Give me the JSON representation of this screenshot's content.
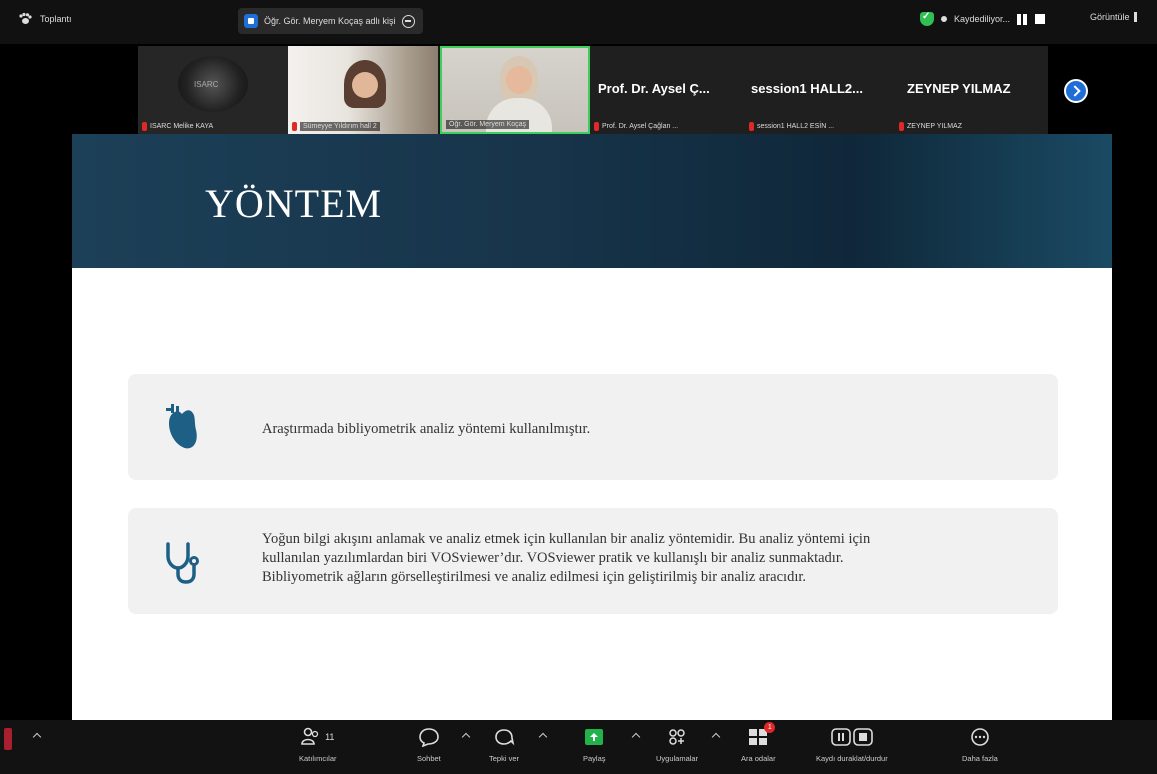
{
  "topbar": {
    "app_name": "Toplantı",
    "share_label": "Öğr. Gör. Meryem Koçaş adlı kişi",
    "recording_label": "Kaydediliyor...",
    "view_label": "Görüntüle"
  },
  "participants": [
    {
      "display": "logo",
      "name": "ISARC Melike KAYA"
    },
    {
      "display": "video",
      "name": "Sümeyye Yıldırım hall 2"
    },
    {
      "display": "video",
      "name": "Öğr. Gör. Meryem Koçaş"
    },
    {
      "display": "name",
      "big_name": "Prof. Dr. Aysel Ç...",
      "name": "Prof. Dr. Aysel Çağlan ..."
    },
    {
      "display": "name",
      "big_name": "session1 HALL2...",
      "name": "session1 HALL2 ESİN ..."
    },
    {
      "display": "name",
      "big_name": "ZEYNEP YILMAZ",
      "name": "ZEYNEP YILMAZ"
    }
  ],
  "slide": {
    "title": "YÖNTEM",
    "card1": {
      "icon": "heart-icon",
      "text": "Araştırmada bibliyometrik analiz yöntemi kullanılmıştır."
    },
    "card2": {
      "icon": "stethoscope-icon",
      "lines": [
        "Yoğun bilgi akışını anlamak ve analiz etmek için kullanılan bir analiz yöntemidir. Bu analiz yöntemi için",
        "kullanılan yazılımlardan biri VOSviewer’dır. VOSviewer pratik ve kullanışlı bir analiz sunmaktadır.",
        "Bibliyometrik ağların görselleştirilmesi ve analiz edilmesi için geliştirilmiş bir analiz aracıdır."
      ]
    }
  },
  "toolbar": {
    "participants_label": "Katılımcılar",
    "participants_count": "11",
    "chat_label": "Sohbet",
    "react_label": "Tepki ver",
    "share_label": "Paylaş",
    "apps_label": "Uygulamalar",
    "breakout_label": "Ara odalar",
    "breakout_badge": "1",
    "record_label": "Kaydı duraklat/durdur",
    "more_label": "Daha fazla"
  },
  "colors": {
    "accent": "#1f6dd6",
    "active_border": "#3ecf5a",
    "icon_teal": "#1e5f86",
    "share_green": "#22b24c",
    "mic_red": "#e02828"
  }
}
